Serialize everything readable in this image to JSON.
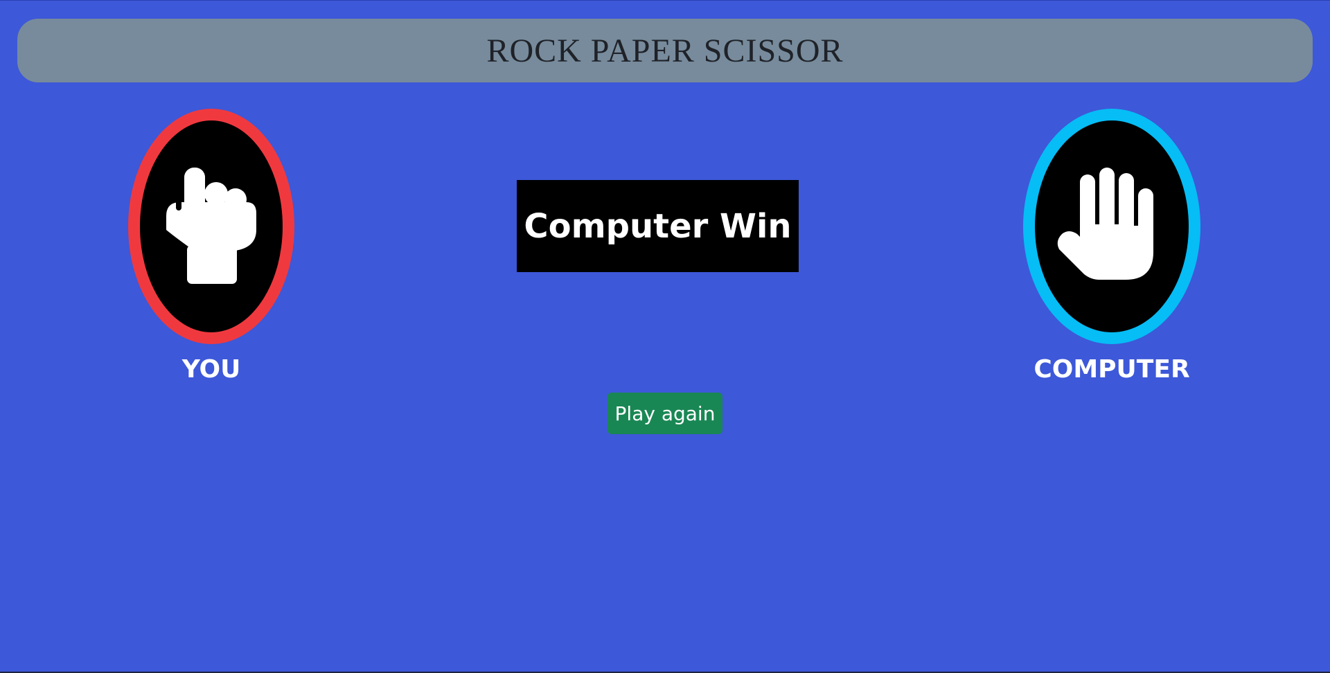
{
  "header": {
    "title": "ROCK PAPER SCISSOR"
  },
  "players": {
    "you": {
      "label": "YOU",
      "choice_icon": "rock-fist-icon",
      "ring_color": "#f0393f"
    },
    "computer": {
      "label": "COMPUTER",
      "choice_icon": "paper-hand-icon",
      "ring_color": "#06bdf6"
    }
  },
  "result": {
    "text": "Computer Win"
  },
  "actions": {
    "play_again_label": "Play again",
    "play_again_color": "#198754"
  },
  "theme": {
    "background": "#3d58d8",
    "header_background": "#778b9c"
  }
}
